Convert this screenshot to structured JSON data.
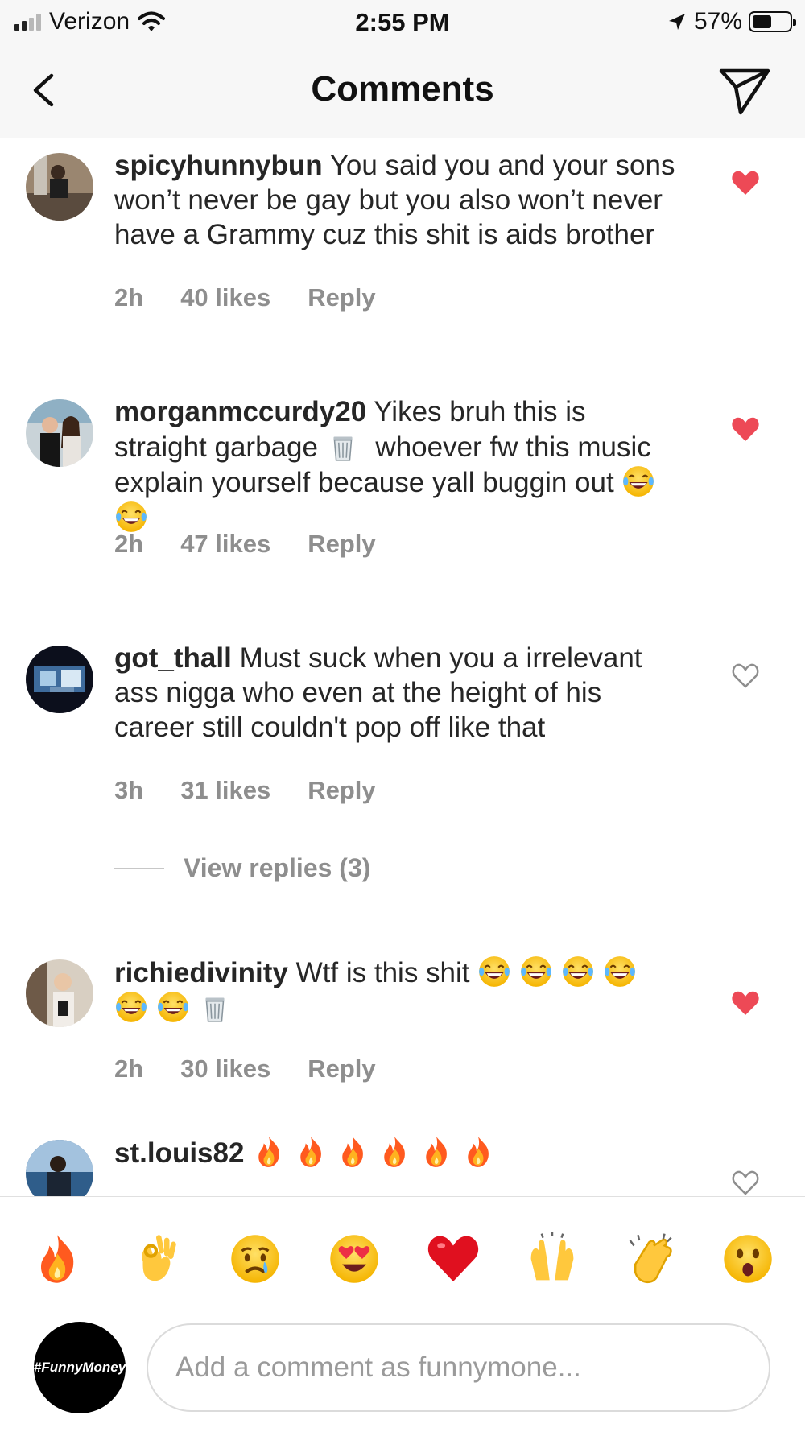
{
  "status_bar": {
    "carrier": "Verizon",
    "time": "2:55 PM",
    "battery_percent": "57%",
    "battery_level": 0.57,
    "icons": [
      "signal-icon",
      "wifi-icon",
      "location-arrow-icon",
      "battery-icon"
    ]
  },
  "nav": {
    "title": "Comments",
    "back_icon": "chevron-left-icon",
    "share_icon": "paper-plane-icon"
  },
  "comments": [
    {
      "username": "spicyhunnybun",
      "text": "You said you and your sons won’t never be gay but you also won’t never have a Grammy cuz this shit is aids brother",
      "time": "2h",
      "likes": "40 likes",
      "reply": "Reply",
      "liked": true
    },
    {
      "username": "morganmccurdy20",
      "text": "Yikes bruh this is straight garbage",
      "text2": "whoever fw this music explain yourself because yall buggin out",
      "time": "2h",
      "likes": "47 likes",
      "reply": "Reply",
      "liked": true
    },
    {
      "username": "got_thall",
      "text": "Must suck when you a irrelevant ass nigga who even at the height of his career still couldn't pop off like that",
      "time": "3h",
      "likes": "31 likes",
      "reply": "Reply",
      "liked": false,
      "view_replies": "View replies (3)"
    },
    {
      "username": "richiedivinity",
      "text": "Wtf is this shit",
      "time": "2h",
      "likes": "30 likes",
      "reply": "Reply",
      "liked": true
    },
    {
      "username": "st.louis82",
      "text": "",
      "liked": false
    }
  ],
  "quick_emojis": [
    "fire-emoji",
    "ok-hand-emoji",
    "crying-face-emoji",
    "heart-eyes-emoji",
    "red-heart-emoji",
    "raised-hands-emoji",
    "clapping-hands-emoji",
    "surprised-face-emoji"
  ],
  "composer": {
    "avatar_text": "#FunnyMoney",
    "placeholder": "Add a comment as funnymone..."
  },
  "colors": {
    "liked_heart": "#ed4956",
    "meta_gray": "#8e8e8e",
    "text": "#262626",
    "header_bg": "#f7f7f7"
  }
}
